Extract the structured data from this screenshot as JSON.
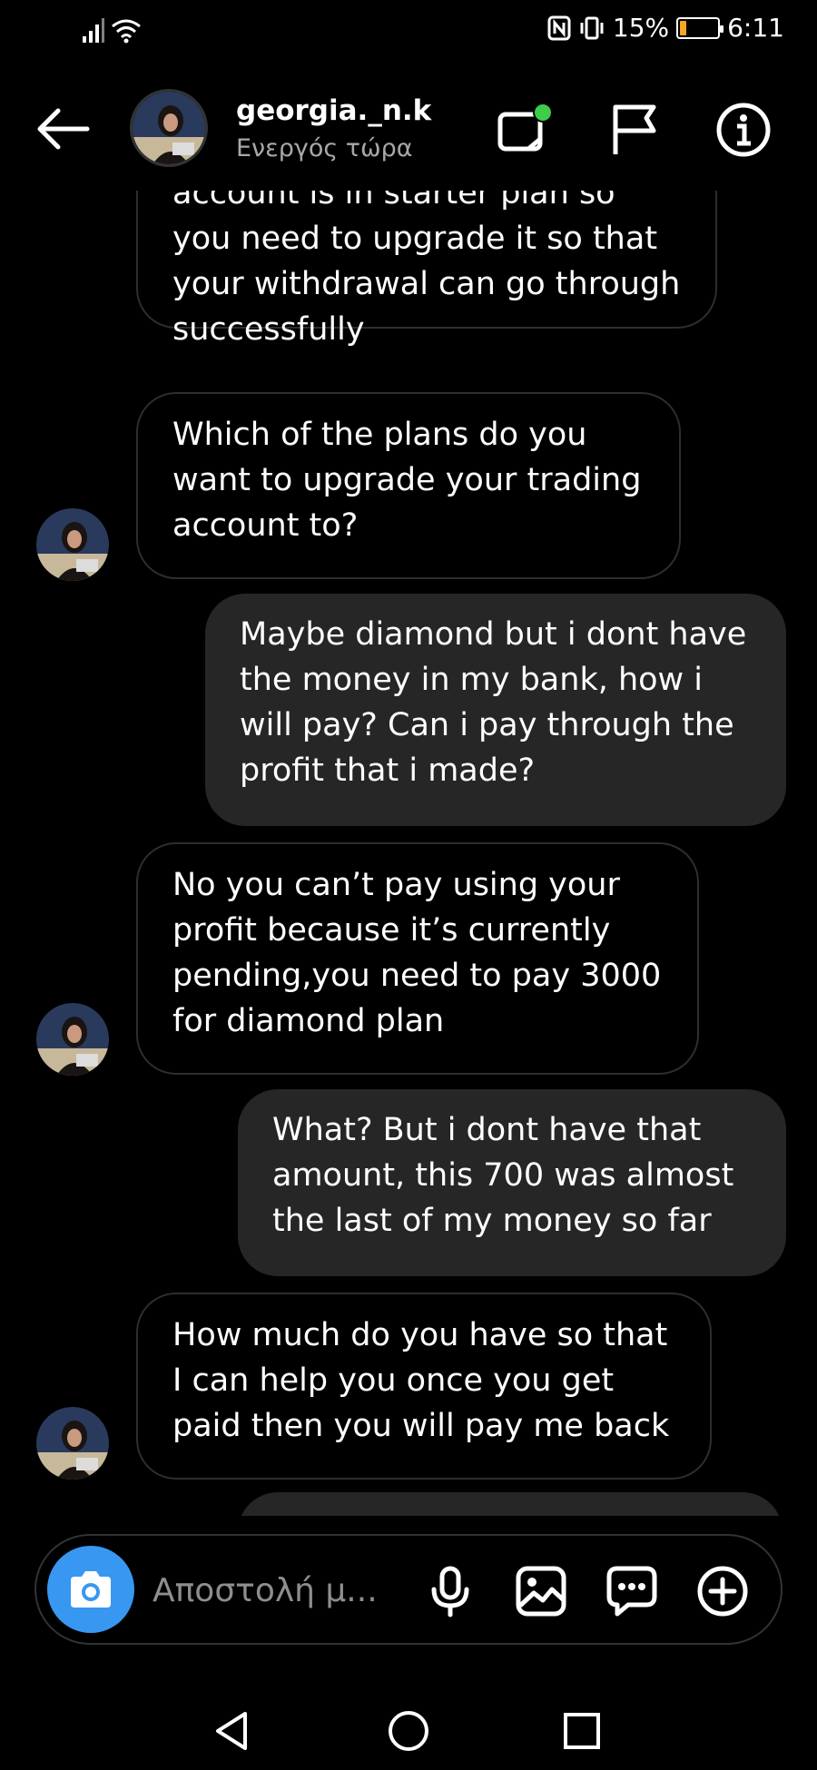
{
  "status_bar": {
    "battery_text": "15%",
    "battery_level": 0.15,
    "time": "6:11"
  },
  "header": {
    "username": "georgia._n.k",
    "activity": "Ενεργός τώρα"
  },
  "messages": [
    {
      "direction": "in",
      "lines": [
        "account is in starter plan so",
        "you need to upgrade it so that",
        "your withdrawal can go through",
        "successfully"
      ]
    },
    {
      "direction": "in",
      "lines": [
        "Which of the plans do you",
        "want to upgrade your trading",
        "account to?"
      ]
    },
    {
      "direction": "out",
      "lines": [
        "Maybe diamond but i dont have",
        "the money in my bank, how i",
        "will pay? Can i pay through the",
        "profit that i made?"
      ]
    },
    {
      "direction": "in",
      "lines": [
        "No you can’t pay using your",
        "profit because it’s currently",
        "pending,you need to pay 3000",
        "for diamond plan"
      ]
    },
    {
      "direction": "out",
      "lines": [
        "What? But i dont have that",
        "amount, this 700 was almost",
        "the last of my money so far"
      ]
    },
    {
      "direction": "in",
      "lines": [
        "How much do you have so that",
        "I can help you once you get",
        "paid then you will pay me back"
      ]
    }
  ],
  "composer": {
    "placeholder": "Αποστολή μ..."
  },
  "colors": {
    "accent": "#3897f0",
    "online_dot": "#3fcc4a",
    "outgoing_bubble": "#262626",
    "battery_fill": "#f5a623"
  }
}
